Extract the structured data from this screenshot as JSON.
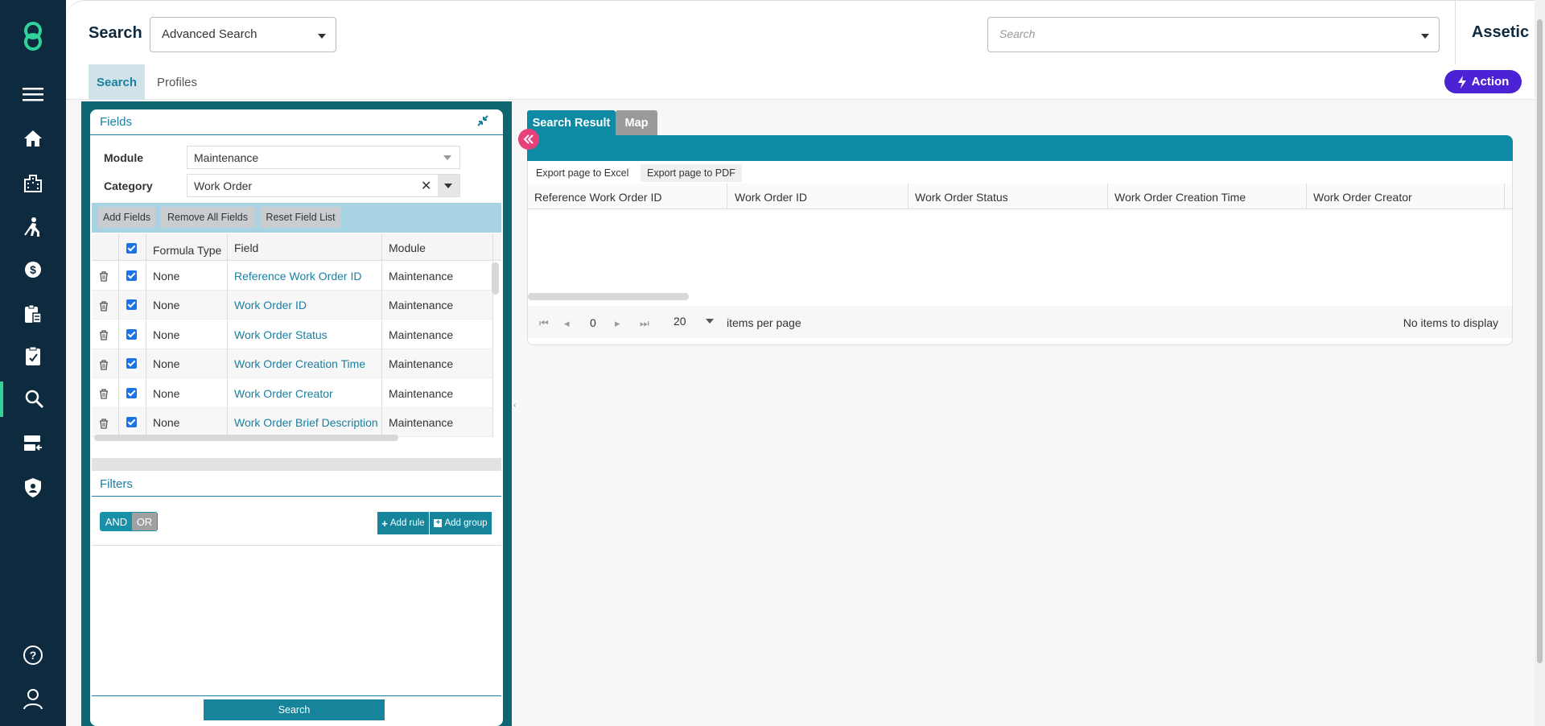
{
  "header": {
    "page_title": "Search",
    "mode_select_value": "Advanced Search",
    "global_search_placeholder": "Search",
    "brand": "Assetic"
  },
  "subnav": {
    "tabs": [
      {
        "label": "Search",
        "active": true
      },
      {
        "label": "Profiles",
        "active": false
      }
    ],
    "action_label": "Action"
  },
  "sidebar": {
    "items": [
      {
        "name": "menu-icon"
      },
      {
        "name": "home-icon"
      },
      {
        "name": "buildings-icon"
      },
      {
        "name": "worker-icon"
      },
      {
        "name": "finance-icon"
      },
      {
        "name": "clipboard-icon"
      },
      {
        "name": "task-icon"
      },
      {
        "name": "search-icon",
        "active": true
      },
      {
        "name": "server-icon"
      },
      {
        "name": "shield-icon"
      }
    ],
    "bottom": [
      {
        "name": "help-icon"
      },
      {
        "name": "user-icon"
      }
    ],
    "accent": "#2fd49a"
  },
  "fields_panel": {
    "title": "Fields",
    "module_label": "Module",
    "module_value": "Maintenance",
    "category_label": "Category",
    "category_value": "Work Order",
    "toolbar": {
      "add_fields": "Add Fields",
      "remove_all": "Remove All Fields",
      "reset": "Reset Field List"
    },
    "columns": {
      "formula_type": "Formula Type",
      "field": "Field",
      "module": "Module"
    },
    "rows": [
      {
        "formula": "None",
        "field": "Reference Work Order ID",
        "module": "Maintenance"
      },
      {
        "formula": "None",
        "field": "Work Order ID",
        "module": "Maintenance"
      },
      {
        "formula": "None",
        "field": "Work Order Status",
        "module": "Maintenance"
      },
      {
        "formula": "None",
        "field": "Work Order Creation Time",
        "module": "Maintenance"
      },
      {
        "formula": "None",
        "field": "Work Order Creator",
        "module": "Maintenance"
      },
      {
        "formula": "None",
        "field": "Work Order Brief Description",
        "module": "Maintenance"
      }
    ]
  },
  "filters_panel": {
    "title": "Filters",
    "and_label": "AND",
    "or_label": "OR",
    "add_rule": "Add rule",
    "add_group": "Add group",
    "search_button": "Search"
  },
  "results": {
    "tabs": [
      {
        "label": "Search Result",
        "active": true
      },
      {
        "label": "Map",
        "active": false
      }
    ],
    "export_excel": "Export page to Excel",
    "export_pdf": "Export page to PDF",
    "columns": [
      "Reference Work Order ID",
      "Work Order ID",
      "Work Order Status",
      "Work Order Creation Time",
      "Work Order Creator"
    ],
    "pager": {
      "page": "0",
      "page_size": "20",
      "items_per_page_label": "items per page",
      "status": "No items to display"
    }
  },
  "colors": {
    "sidebar": "#0e2a3e",
    "teal": "#0e8aa5",
    "action": "#4b22d4",
    "back_button": "#e8417a"
  }
}
